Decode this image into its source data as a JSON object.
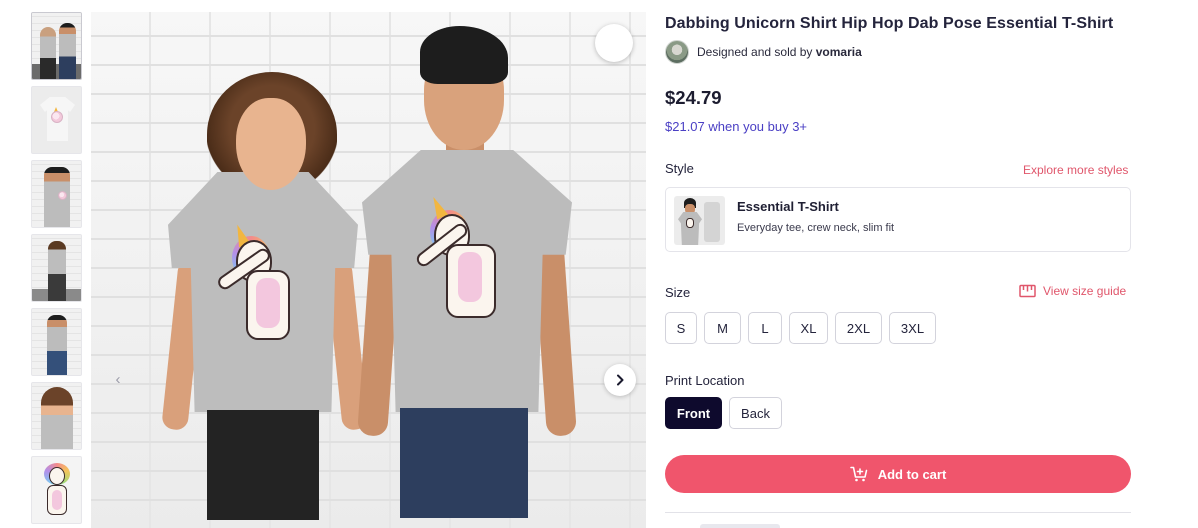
{
  "product": {
    "title": "Dabbing Unicorn Shirt Hip Hop Dab Pose Essential T-Shirt",
    "designed_prefix": "Designed and sold by ",
    "artist": "vomaria",
    "price": "$24.79",
    "bulk_price": "$21.07 when you buy 3+"
  },
  "style": {
    "label": "Style",
    "explore_link": "Explore more styles",
    "selected_name": "Essential T-Shirt",
    "selected_desc": "Everyday tee, crew neck, slim fit"
  },
  "size": {
    "label": "Size",
    "guide_link": "View size guide",
    "options": [
      "S",
      "M",
      "L",
      "XL",
      "2XL",
      "3XL"
    ]
  },
  "print_location": {
    "label": "Print Location",
    "options": [
      "Front",
      "Back"
    ],
    "selected": "Front"
  },
  "cart": {
    "label": "Add to cart"
  },
  "gallery": {
    "thumbnail_count": 7,
    "active_index": 0
  },
  "colors": {
    "accent": "#f0556c",
    "selected_chip": "#0e0a2d",
    "bulk_price": "#4a3fc4",
    "shirt": "#bdbdbd"
  },
  "icons": {
    "favorite": "heart-icon",
    "prev": "chevron-left-icon",
    "next": "chevron-right-icon",
    "size_guide": "ruler-icon",
    "cart": "cart-add-icon"
  }
}
